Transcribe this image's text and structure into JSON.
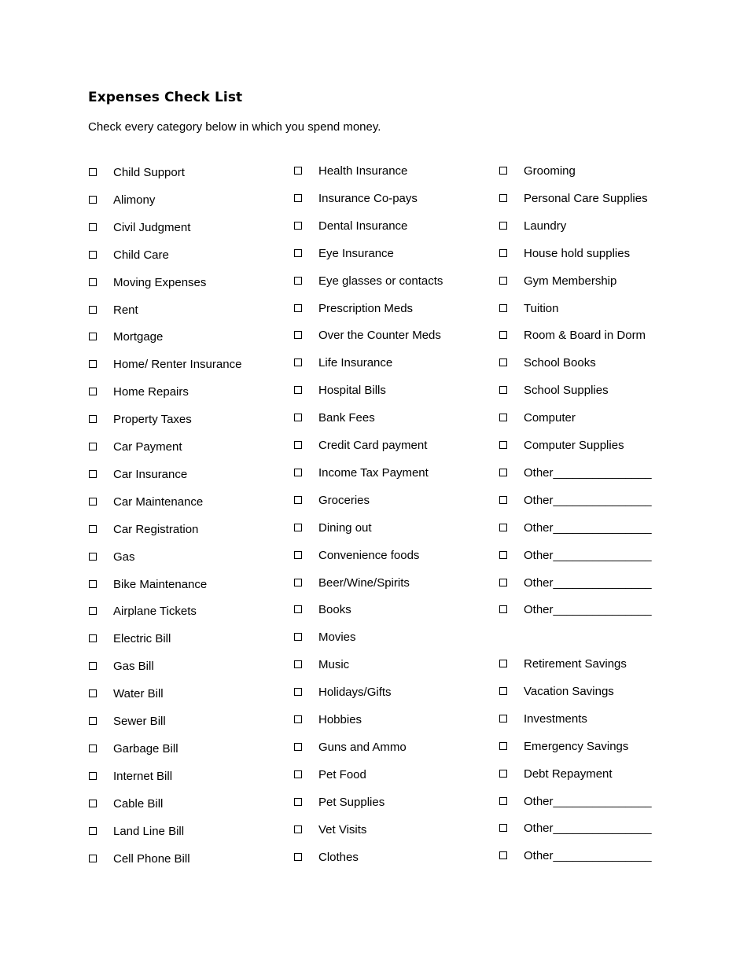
{
  "title": "Expenses Check List",
  "subtitle": "Check every category below in which you spend money.",
  "columns": [
    {
      "items": [
        "Child Support",
        "Alimony",
        "Civil Judgment",
        "Child Care",
        "Moving Expenses",
        "Rent",
        "Mortgage",
        "Home/ Renter Insurance",
        "Home Repairs",
        "Property Taxes",
        "Car Payment",
        "Car Insurance",
        "Car Maintenance",
        "Car Registration",
        "Gas",
        "Bike Maintenance",
        "Airplane Tickets",
        "Electric Bill",
        "Gas Bill",
        "Water Bill",
        "Sewer Bill",
        "Garbage Bill",
        "Internet Bill",
        "Cable Bill",
        "Land Line Bill",
        "Cell Phone Bill"
      ]
    },
    {
      "items": [
        "Health Insurance",
        "Insurance Co-pays",
        "Dental Insurance",
        "Eye Insurance",
        "Eye glasses or contacts",
        "Prescription Meds",
        "Over the Counter Meds",
        "Life Insurance",
        "Hospital Bills",
        "Bank Fees",
        "Credit Card payment",
        "Income Tax Payment",
        "Groceries",
        "Dining out",
        "Convenience foods",
        "Beer/Wine/Spirits",
        "Books",
        "Movies",
        "Music",
        "Holidays/Gifts",
        "Hobbies",
        "Guns and Ammo",
        "Pet Food",
        "Pet Supplies",
        "Vet Visits",
        "Clothes"
      ]
    },
    {
      "items": [
        "Grooming",
        "Personal Care Supplies",
        "Laundry",
        "House hold supplies",
        "Gym Membership",
        "Tuition",
        "Room & Board in Dorm",
        "School Books",
        "School Supplies",
        "Computer",
        "Computer Supplies",
        "Other_______________",
        "Other_______________",
        "Other_______________",
        "Other_______________",
        "Other_______________",
        "Other_______________",
        "Retirement Savings",
        "Vacation Savings",
        "Investments",
        "Emergency Savings",
        "Debt Repayment",
        "Other_______________",
        "Other_______________",
        "Other_______________"
      ]
    }
  ]
}
